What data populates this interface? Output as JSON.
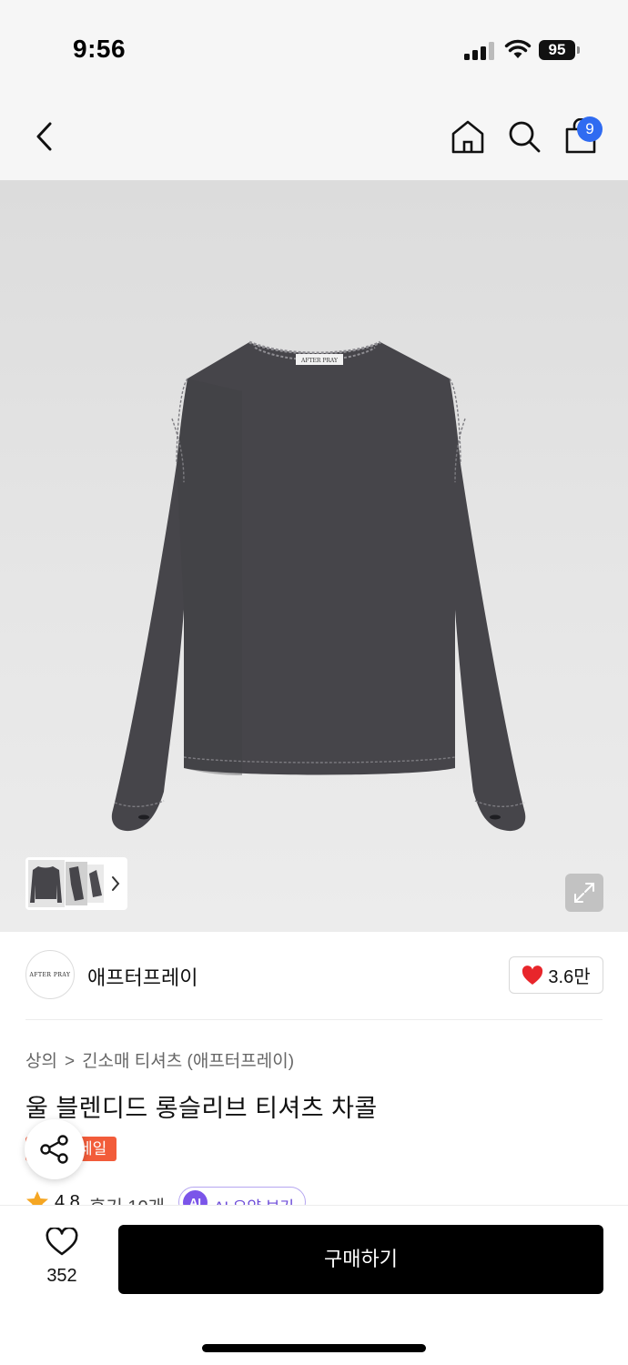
{
  "status_bar": {
    "time": "9:56",
    "battery": "95"
  },
  "nav": {
    "cart_badge": "9"
  },
  "brand": {
    "logo_text": "AFTER PRAY",
    "name": "애프터프레이",
    "likes": "3.6만"
  },
  "product": {
    "breadcrumb": [
      "상의",
      "긴소매 티셔츠 (애프터프레이)"
    ],
    "title": "울 블렌디드 롱슬리브 티셔츠 차콜",
    "sale_badge": "세일",
    "rating": "4.8",
    "reviews": "후기 10개",
    "ai_badge": "AI",
    "ai_summary_label": "AI 요약 보기",
    "shirt_label": "AFTER PRAY"
  },
  "bottom": {
    "wish_count": "352",
    "buy_label": "구매하기"
  },
  "colors": {
    "accent_blue": "#2f6bf1",
    "sale_red": "#f25c3a",
    "ai_purple": "#7b55e9",
    "heart_red": "#e8262b",
    "garment": "#46454a"
  }
}
